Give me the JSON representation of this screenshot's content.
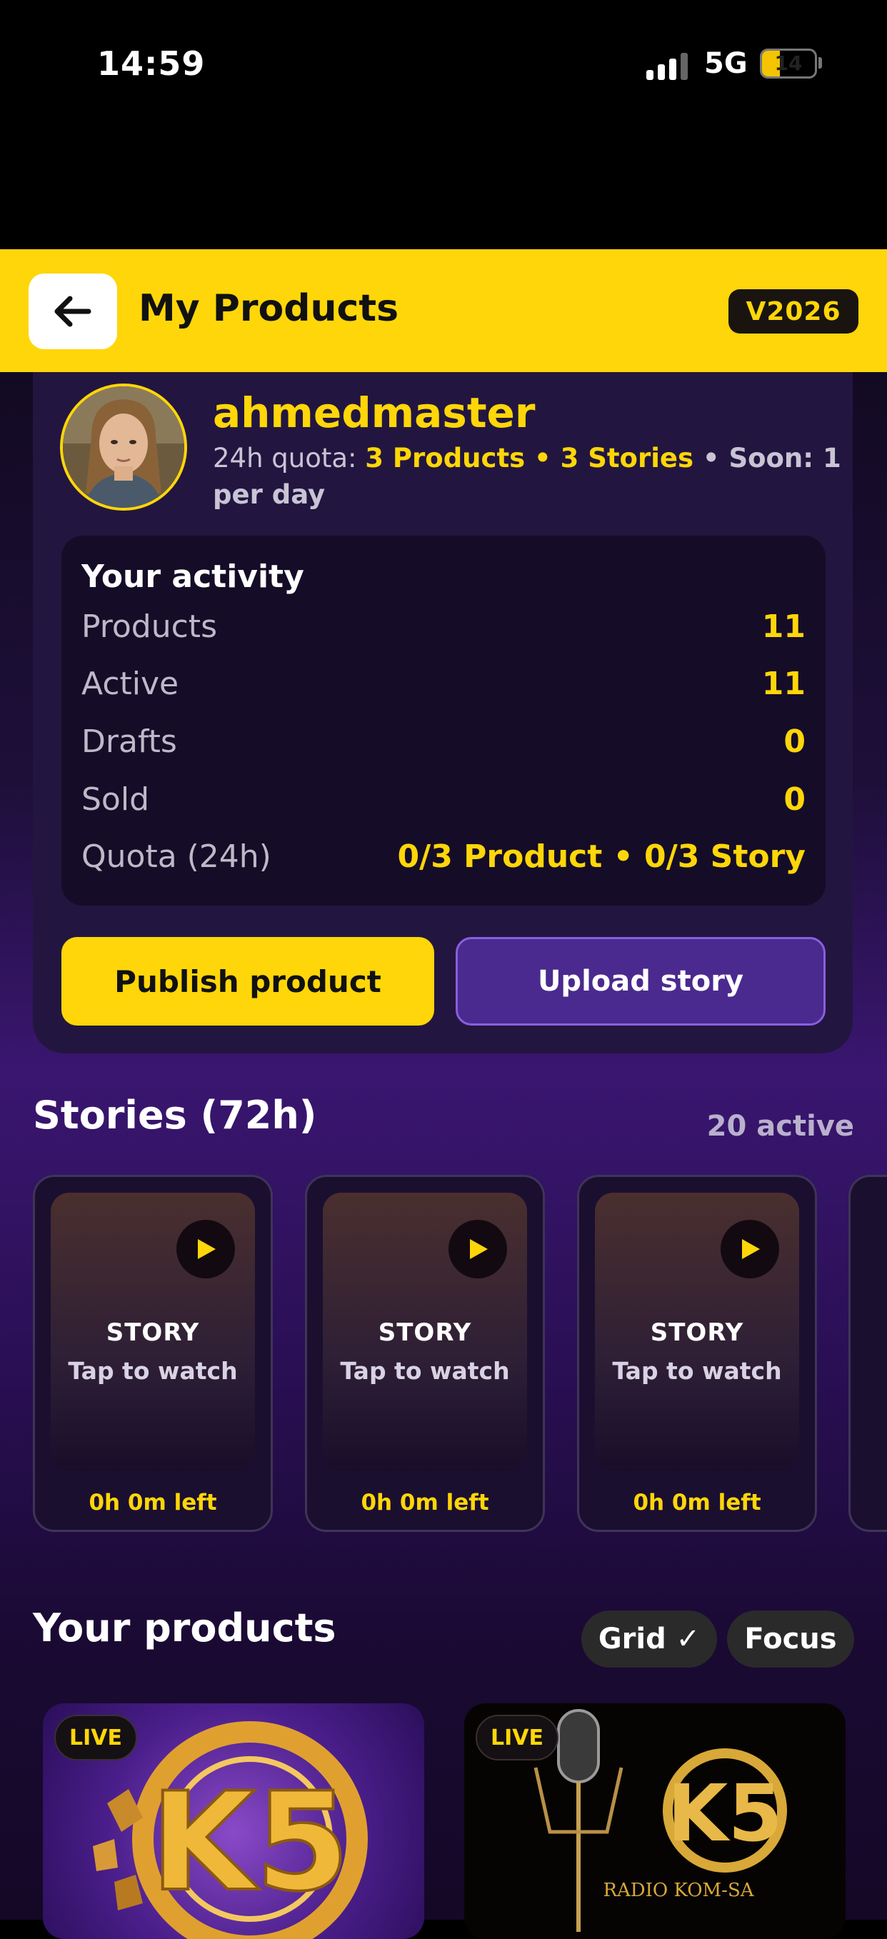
{
  "status_bar": {
    "time": "14:59",
    "network": "5G",
    "battery": "14",
    "battery_level": 0.14
  },
  "header": {
    "title": "My Products",
    "version": "V2026",
    "back_icon": "arrow-left-icon"
  },
  "profile": {
    "username": "ahmedmaster",
    "quota_prefix": "24h quota: ",
    "quota_products": "3 Products",
    "quota_sep": " • ",
    "quota_stories": "3 Stories",
    "quota_soon": " • Soon: 1 per day"
  },
  "activity": {
    "title": "Your activity",
    "rows": [
      {
        "label": "Products",
        "value": "11"
      },
      {
        "label": "Active",
        "value": "11"
      },
      {
        "label": "Drafts",
        "value": "0"
      },
      {
        "label": "Sold",
        "value": "0"
      },
      {
        "label": "Quota (24h)",
        "value": "0/3 Product • 0/3 Story"
      }
    ]
  },
  "actions": {
    "publish": "Publish product",
    "upload_story": "Upload story"
  },
  "stories": {
    "title": "Stories (72h)",
    "count": "20 active",
    "items": [
      {
        "label": "STORY",
        "sub": "Tap to watch",
        "left": "0h 0m left"
      },
      {
        "label": "STORY",
        "sub": "Tap to watch",
        "left": "0h 0m left"
      },
      {
        "label": "STORY",
        "sub": "Tap to watch",
        "left": "0h 0m left"
      }
    ]
  },
  "products": {
    "title": "Your products",
    "view_grid": "Grid ✓",
    "view_focus": "Focus",
    "items": [
      {
        "badge": "LIVE",
        "logo_text": "K5"
      },
      {
        "badge": "LIVE",
        "logo_text": "K5",
        "caption": "RADIO KOM-SA"
      }
    ]
  },
  "colors": {
    "accent": "#fed609",
    "purple": "#4a2a8e",
    "bg_dark": "#150d27"
  }
}
